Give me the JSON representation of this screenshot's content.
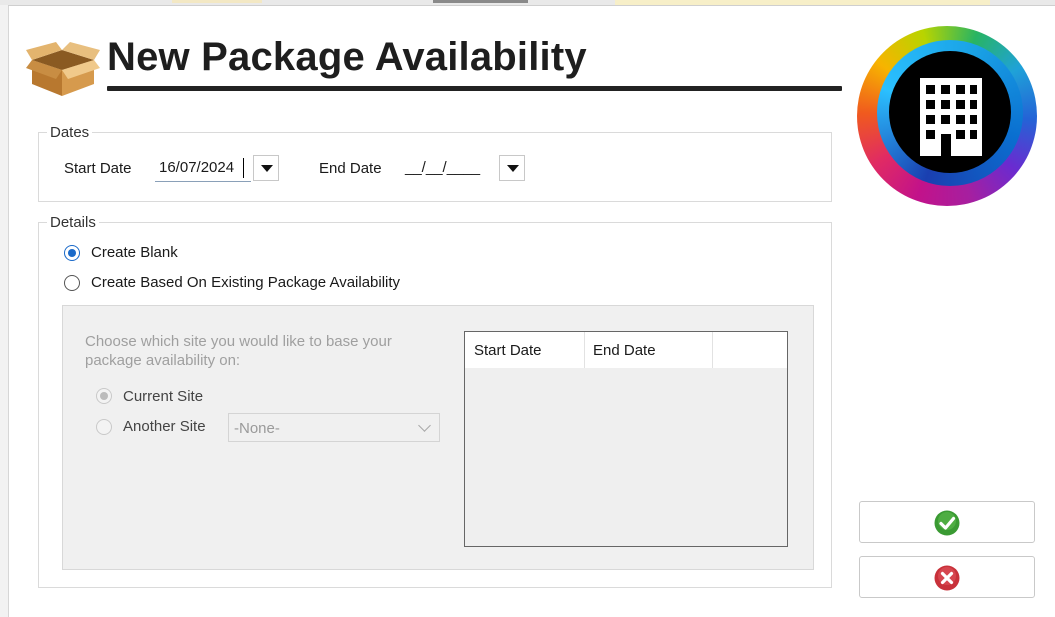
{
  "dialog": {
    "title": "New Package Availability"
  },
  "dates": {
    "legend": "Dates",
    "start_label": "Start Date",
    "start_value": "16/07/2024",
    "end_label": "End Date",
    "end_value": "__/__/____"
  },
  "details": {
    "legend": "Details",
    "options": [
      {
        "label": "Create Blank",
        "selected": true
      },
      {
        "label": "Create Based On Existing Package Availability",
        "selected": false
      }
    ],
    "base_prompt_line1": "Choose which site you would like to base your",
    "base_prompt_line2": "package availability on:",
    "site_options": [
      {
        "label": "Current Site",
        "selected": true
      },
      {
        "label": "Another Site",
        "selected": false
      }
    ],
    "site_select_value": "-None-",
    "grid_columns": [
      "Start Date",
      "End Date",
      ""
    ]
  },
  "icons": {
    "package": "package-box-icon",
    "logo": "building-logo-icon",
    "confirm": "checkmark-icon",
    "cancel": "close-x-icon"
  },
  "colors": {
    "confirm_green": "#3a9a33",
    "cancel_red": "#c8313a",
    "radio_blue": "#1b6ac9"
  }
}
